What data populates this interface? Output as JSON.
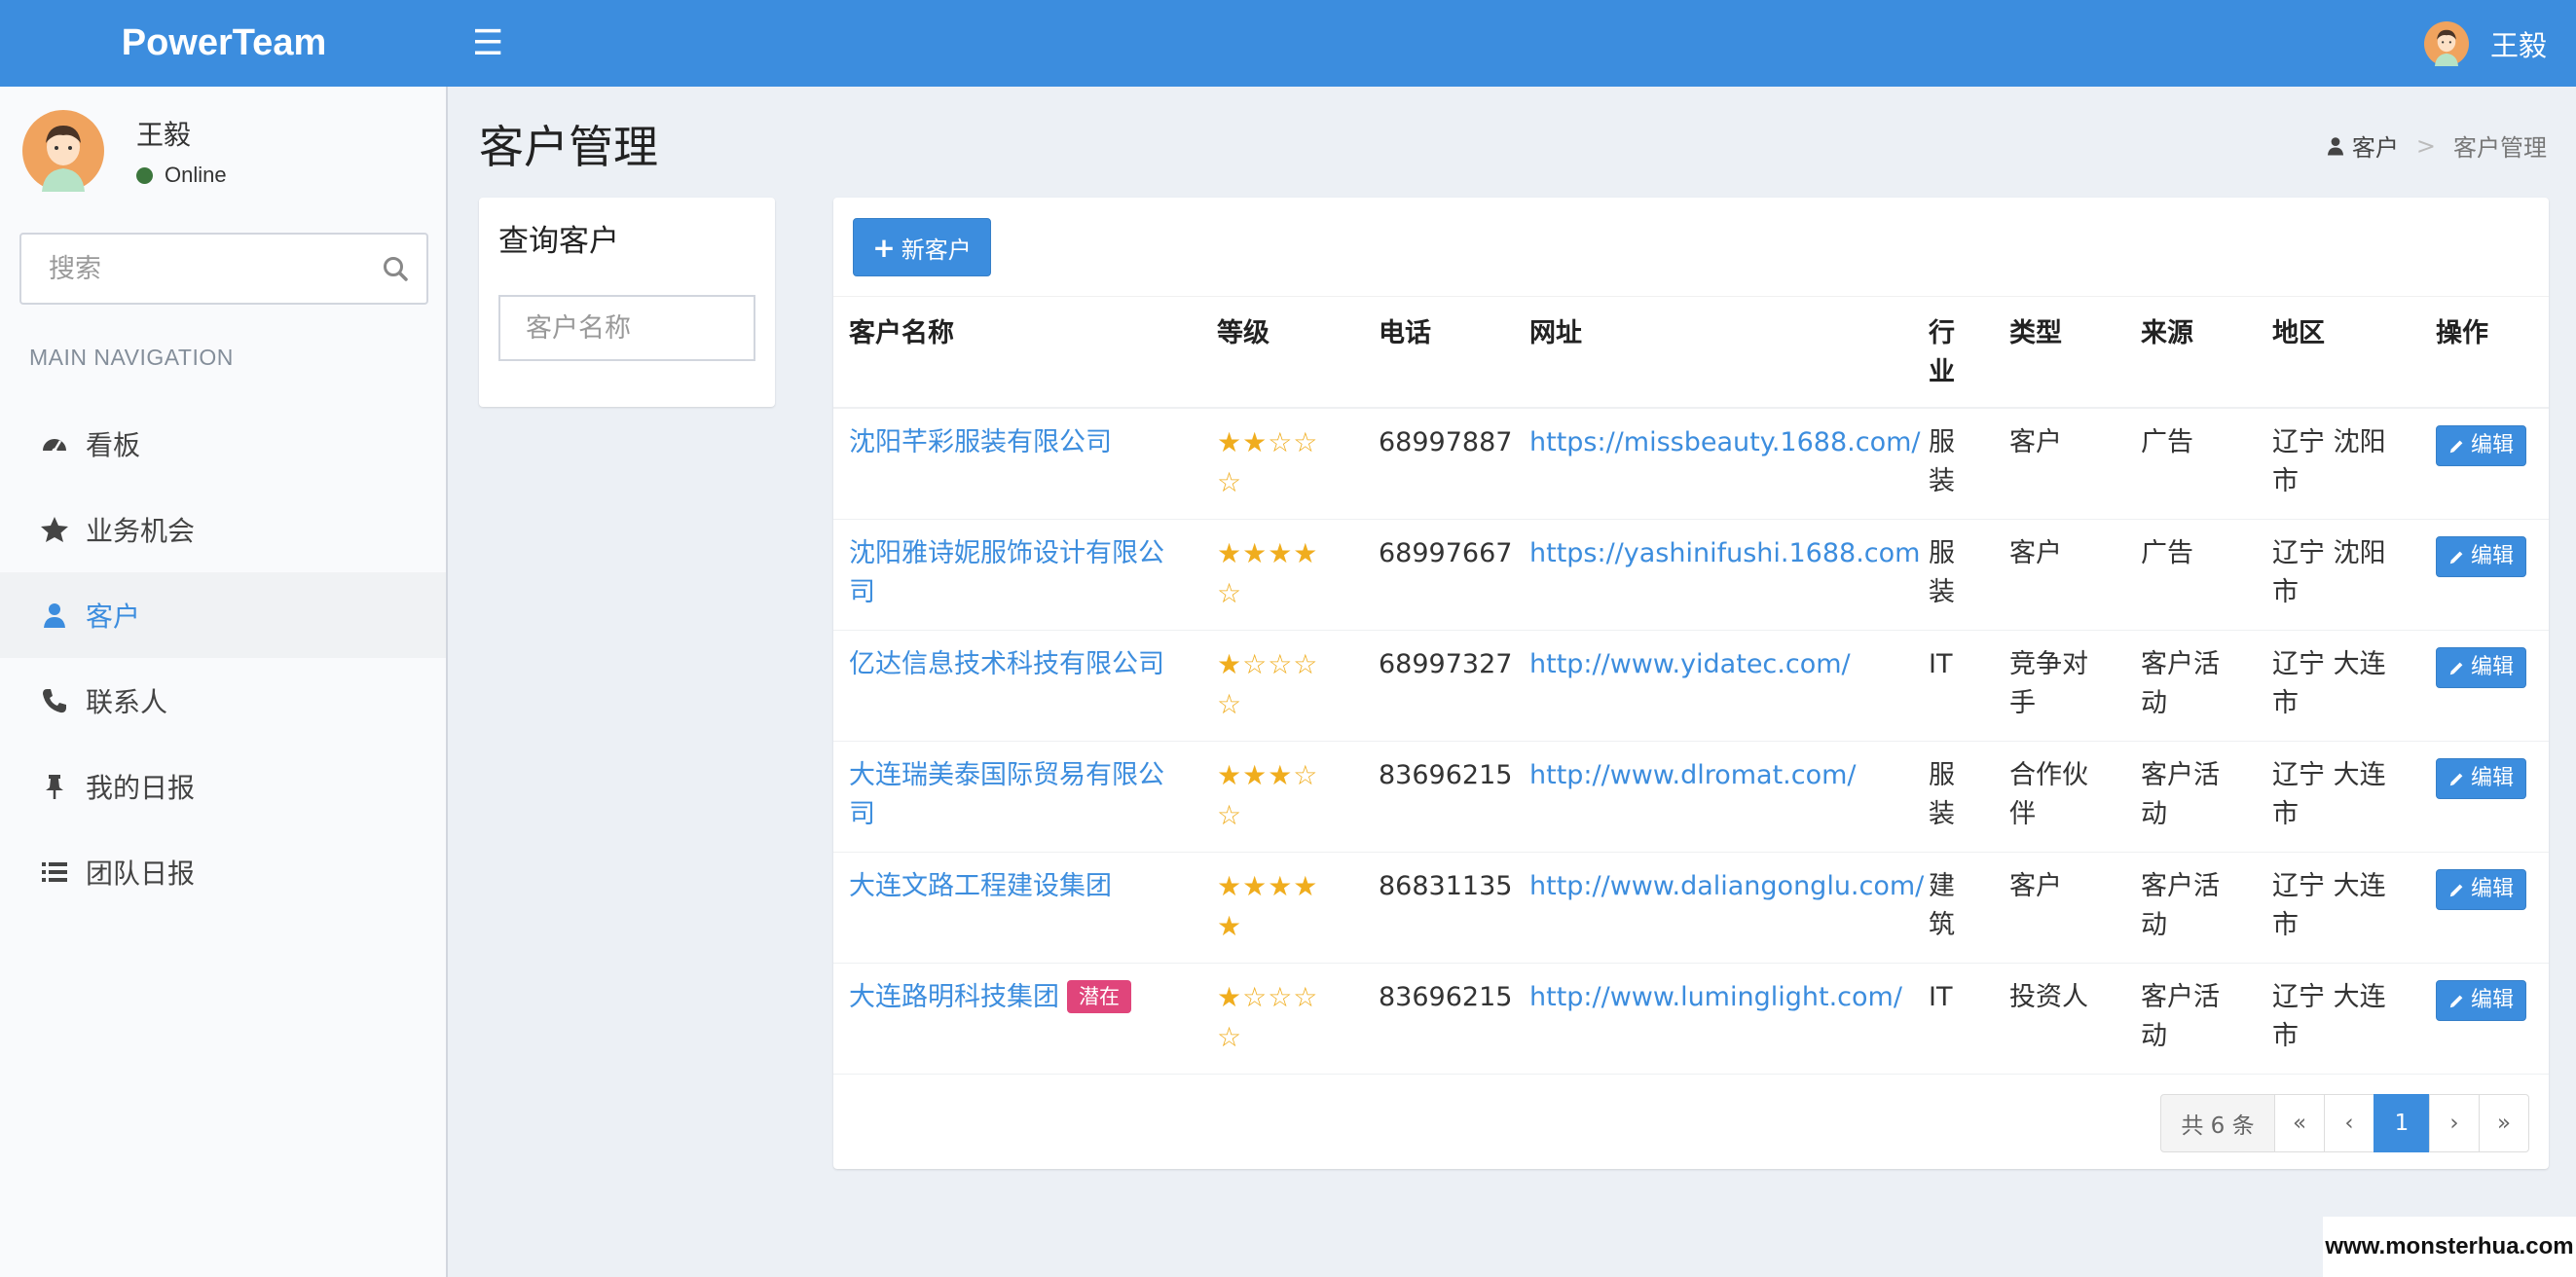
{
  "header": {
    "logo": "PowerTeam",
    "user_name": "王毅"
  },
  "sidebar": {
    "user": {
      "name": "王毅",
      "status": "Online"
    },
    "search_placeholder": "搜索",
    "nav_header": "MAIN NAVIGATION",
    "items": [
      {
        "label": "看板",
        "icon": "dashboard-icon"
      },
      {
        "label": "业务机会",
        "icon": "star-icon"
      },
      {
        "label": "客户",
        "icon": "user-icon",
        "active": true
      },
      {
        "label": "联系人",
        "icon": "phone-icon"
      },
      {
        "label": "我的日报",
        "icon": "pin-icon"
      },
      {
        "label": "团队日报",
        "icon": "list-icon"
      }
    ]
  },
  "content": {
    "title": "客户管理",
    "breadcrumb": {
      "parent": "客户",
      "current": "客户管理"
    }
  },
  "query": {
    "title": "查询客户",
    "name_placeholder": "客户名称"
  },
  "table": {
    "new_button": "新客户",
    "columns": [
      "客户名称",
      "等级",
      "电话",
      "网址",
      "行业",
      "类型",
      "来源",
      "地区",
      "操作"
    ],
    "edit_label": "编辑",
    "rows": [
      {
        "name": "沈阳芊彩服装有限公司",
        "rating": 2,
        "phone": "68997887",
        "url": "https://missbeauty.1688.com/",
        "industry": "服装",
        "type": "客户",
        "source": "广告",
        "region": "辽宁 沈阳市"
      },
      {
        "name": "沈阳雅诗妮服饰设计有限公司",
        "rating": 4,
        "phone": "68997667",
        "url": "https://yashinifushi.1688.com",
        "industry": "服装",
        "type": "客户",
        "source": "广告",
        "region": "辽宁 沈阳市"
      },
      {
        "name": "亿达信息技术科技有限公司",
        "rating": 1,
        "phone": "68997327",
        "url": "http://www.yidatec.com/",
        "industry": "IT",
        "type": "竞争对手",
        "source": "客户活动",
        "region": "辽宁 大连市"
      },
      {
        "name": "大连瑞美泰国际贸易有限公司",
        "rating": 3,
        "phone": "83696215",
        "url": "http://www.dlromat.com/",
        "industry": "服装",
        "type": "合作伙伴",
        "source": "客户活动",
        "region": "辽宁 大连市"
      },
      {
        "name": "大连文路工程建设集团",
        "rating": 5,
        "phone": "86831135",
        "url": "http://www.daliangonglu.com/",
        "industry": "建筑",
        "type": "客户",
        "source": "客户活动",
        "region": "辽宁 大连市"
      },
      {
        "name": "大连路明科技集团",
        "tag": "潜在",
        "rating": 1,
        "phone": "83696215",
        "url": "http://www.luminglight.com/",
        "industry": "IT",
        "type": "投资人",
        "source": "客户活动",
        "region": "辽宁 大连市"
      }
    ]
  },
  "pagination": {
    "total": "共 6 条",
    "first": "«",
    "prev": "‹",
    "page": "1",
    "next": "›",
    "last": "»"
  },
  "watermark": "www.monsterhua.com",
  "colors": {
    "primary": "#3c8dde",
    "star": "#f0ad1e",
    "tag": "#e0457b",
    "online": "#3c763d"
  }
}
